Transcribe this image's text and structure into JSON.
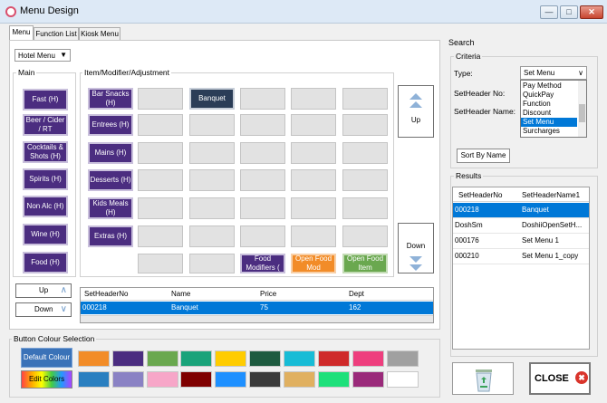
{
  "window": {
    "title": "Menu Design"
  },
  "tabs": [
    "Menu",
    "Function List",
    "Kiosk Menu"
  ],
  "menu_select": {
    "value": "Hotel Menu"
  },
  "main": {
    "label": "Main",
    "buttons": [
      "Fast (H)",
      "Beer / Cider / RT",
      "Cocktails & Shots (H)",
      "Spirits (H)",
      "Non Alc (H)",
      "Wine (H)",
      "Food (H)"
    ],
    "up_label": "Up",
    "down_label": "Down"
  },
  "items": {
    "label": "Item/Modifier/Adjustment",
    "col1": [
      "Bar Snacks (H)",
      "Entrees (H)",
      "Mains (H)",
      "Desserts (H)",
      "Kids Meals (H)",
      "Extras (H)"
    ],
    "banquet": "Banquet",
    "food_modifiers": "Food Modifiers (",
    "open_food_mod": "Open Food Mod",
    "open_food_item": "Open Food Item",
    "up_label": "Up",
    "down_label": "Down"
  },
  "table": {
    "columns": [
      "SetHeaderNo",
      "Name",
      "Price",
      "Dept"
    ],
    "rows": [
      [
        "000218",
        "Banquet",
        "75",
        "162"
      ]
    ]
  },
  "colour_selection": {
    "label": "Button Colour Selection",
    "default_label": "Default Colour",
    "edit_label": "Edit Colors",
    "row1": [
      "#f28c28",
      "#4b2d80",
      "#6aa84f",
      "#1aa37a",
      "#ffcc00",
      "#1e5b40",
      "#18bcd6",
      "#cf2a2a",
      "#ee3f7e",
      "#a0a0a0"
    ],
    "row2": [
      "#2a7fc0",
      "#8a82c4",
      "#f7a6c8",
      "#7f0000",
      "#1e90ff",
      "#3a3a3a",
      "#e0b060",
      "#1de07a",
      "#9a2a7a",
      "#ffffff"
    ]
  },
  "search": {
    "label": "Search",
    "criteria_label": "Criteria",
    "type_label": "Type:",
    "type_value": "Set Menu",
    "type_options": [
      "Pay Method",
      "QuickPay",
      "Function",
      "Discount",
      "Set Menu",
      "Surcharges"
    ],
    "type_selected_index": 4,
    "setheader_no_label": "SetHeader No:",
    "setheader_name_label": "SetHeader Name:",
    "sort_button": "Sort By Name"
  },
  "results": {
    "label": "Results",
    "columns": [
      "SetHeaderNo",
      "SetHeaderName1"
    ],
    "rows": [
      [
        "000218",
        "Banquet"
      ],
      [
        "DoshSm",
        "DoshiiOpenSetH..."
      ],
      [
        "000176",
        "Set Menu 1"
      ],
      [
        "000210",
        "Set Menu 1_copy"
      ]
    ],
    "selected_index": 0
  },
  "footer": {
    "close_label": "CLOSE"
  }
}
